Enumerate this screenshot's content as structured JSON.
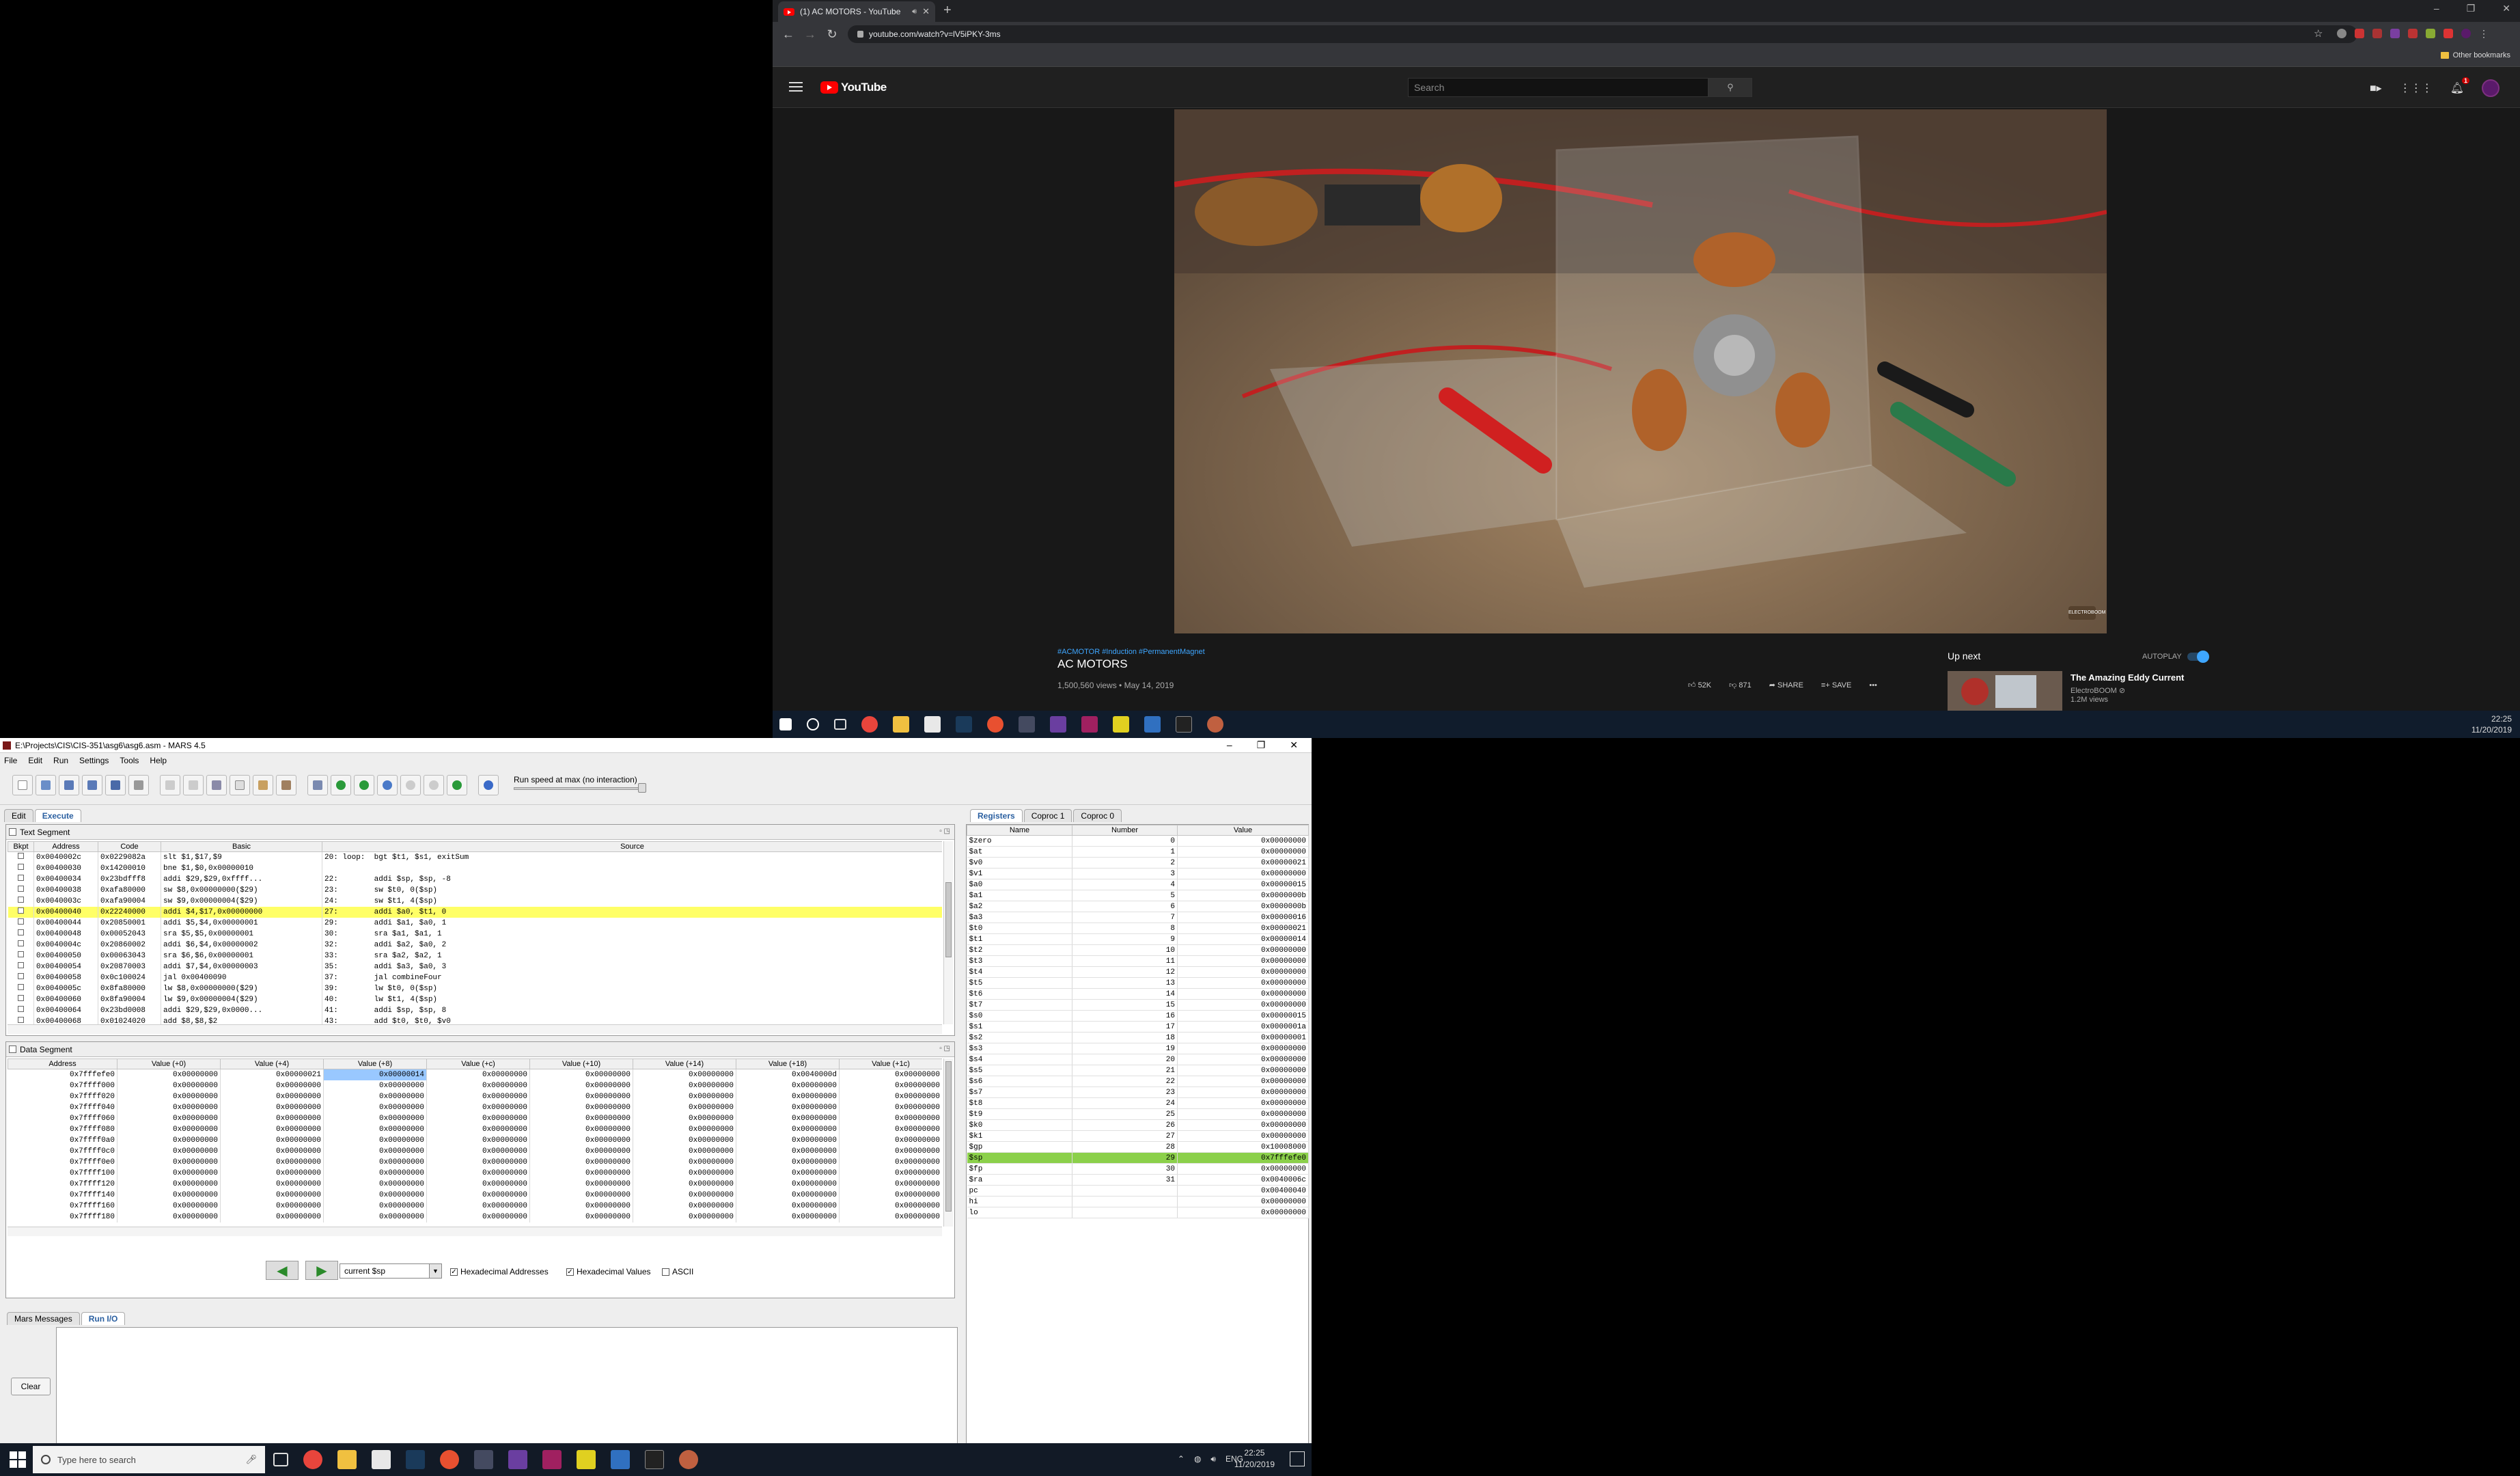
{
  "chrome": {
    "tab_title": "(1) AC MOTORS - YouTube",
    "new_tab": "+",
    "url": "youtube.com/watch?v=lV5iPKY-3ms",
    "other_bookmarks": "Other bookmarks",
    "window_controls": [
      "–",
      "❐",
      "✕"
    ]
  },
  "youtube": {
    "logo_text": "YouTube",
    "search_placeholder": "Search",
    "notification_count": "1",
    "hashtags": "#ACMOTOR #Induction #PermanentMagnet",
    "video_title": "AC MOTORS",
    "video_meta": "1,500,560 views • May 14, 2019",
    "likes": "52K",
    "dislikes": "871",
    "share": "SHARE",
    "save": "SAVE",
    "more": "•••",
    "up_next": "Up next",
    "autoplay": "AUTOPLAY",
    "related_title": "The Amazing Eddy Current",
    "related_channel": "ElectroBOOM ⊘",
    "related_views": "1.2M views",
    "watermark": "ELECTROBOOM"
  },
  "taskbar_top": {
    "time": "22:25",
    "date": "11/20/2019"
  },
  "mars": {
    "title": "E:\\Projects\\CIS\\CIS-351\\asg6\\asg6.asm - MARS 4.5",
    "menu": [
      "File",
      "Edit",
      "Run",
      "Settings",
      "Tools",
      "Help"
    ],
    "speed_label": "Run speed at max (no interaction)",
    "tabs": {
      "edit": "Edit",
      "execute": "Execute"
    },
    "text_segment": {
      "title": "Text Segment",
      "headers": [
        "Bkpt",
        "Address",
        "Code",
        "Basic",
        "Source"
      ],
      "rows": [
        [
          "0x0040002c",
          "0x0229082a",
          "slt $1,$17,$9",
          "20: loop:  bgt $t1, $s1, exitSum"
        ],
        [
          "0x00400030",
          "0x14200010",
          "bne $1,$0,0x00000010",
          ""
        ],
        [
          "0x00400034",
          "0x23bdfff8",
          "addi $29,$29,0xffff...",
          "22:        addi $sp, $sp, -8"
        ],
        [
          "0x00400038",
          "0xafa80000",
          "sw $8,0x00000000($29)",
          "23:        sw $t0, 0($sp)"
        ],
        [
          "0x0040003c",
          "0xafa90004",
          "sw $9,0x00000004($29)",
          "24:        sw $t1, 4($sp)"
        ],
        [
          "0x00400040",
          "0x22240000",
          "addi $4,$17,0x00000000",
          "27:        addi $a0, $t1, 0"
        ],
        [
          "0x00400044",
          "0x20850001",
          "addi $5,$4,0x00000001",
          "29:        addi $a1, $a0, 1"
        ],
        [
          "0x00400048",
          "0x00052043",
          "sra $5,$5,0x00000001",
          "30:        sra $a1, $a1, 1"
        ],
        [
          "0x0040004c",
          "0x20860002",
          "addi $6,$4,0x00000002",
          "32:        addi $a2, $a0, 2"
        ],
        [
          "0x00400050",
          "0x00063043",
          "sra $6,$6,0x00000001",
          "33:        sra $a2, $a2, 1"
        ],
        [
          "0x00400054",
          "0x20870003",
          "addi $7,$4,0x00000003",
          "35:        addi $a3, $a0, 3"
        ],
        [
          "0x00400058",
          "0x0c100024",
          "jal 0x00400090",
          "37:        jal combineFour"
        ],
        [
          "0x0040005c",
          "0x8fa80000",
          "lw $8,0x00000000($29)",
          "39:        lw $t0, 0($sp)"
        ],
        [
          "0x00400060",
          "0x8fa90004",
          "lw $9,0x00000004($29)",
          "40:        lw $t1, 4($sp)"
        ],
        [
          "0x00400064",
          "0x23bd0008",
          "addi $29,$29,0x0000...",
          "41:        addi $sp, $sp, 8"
        ],
        [
          "0x00400068",
          "0x01024020",
          "add $8,$8,$2",
          "43:        add $t0, $t0, $v0"
        ],
        [
          "0x0040006c",
          "0x21290001",
          "addi $9,$9,0x000...",
          "44:        addi $t1, $t1, 1"
        ]
      ]
    },
    "data_segment": {
      "title": "Data Segment",
      "headers": [
        "Address",
        "Value (+0)",
        "Value (+4)",
        "Value (+8)",
        "Value (+c)",
        "Value (+10)",
        "Value (+14)",
        "Value (+18)",
        "Value (+1c)"
      ],
      "rows": [
        [
          "0x7fffefe0",
          "0x00000000",
          "0x00000021",
          "0x00000014",
          "0x00000000",
          "0x00000000",
          "0x00000000",
          "0x0040000d",
          "0x00000000"
        ],
        [
          "0x7ffff000",
          "0x00000000",
          "0x00000000",
          "0x00000000",
          "0x00000000",
          "0x00000000",
          "0x00000000",
          "0x00000000",
          "0x00000000"
        ],
        [
          "0x7ffff020",
          "0x00000000",
          "0x00000000",
          "0x00000000",
          "0x00000000",
          "0x00000000",
          "0x00000000",
          "0x00000000",
          "0x00000000"
        ],
        [
          "0x7ffff040",
          "0x00000000",
          "0x00000000",
          "0x00000000",
          "0x00000000",
          "0x00000000",
          "0x00000000",
          "0x00000000",
          "0x00000000"
        ],
        [
          "0x7ffff060",
          "0x00000000",
          "0x00000000",
          "0x00000000",
          "0x00000000",
          "0x00000000",
          "0x00000000",
          "0x00000000",
          "0x00000000"
        ],
        [
          "0x7ffff080",
          "0x00000000",
          "0x00000000",
          "0x00000000",
          "0x00000000",
          "0x00000000",
          "0x00000000",
          "0x00000000",
          "0x00000000"
        ],
        [
          "0x7ffff0a0",
          "0x00000000",
          "0x00000000",
          "0x00000000",
          "0x00000000",
          "0x00000000",
          "0x00000000",
          "0x00000000",
          "0x00000000"
        ],
        [
          "0x7ffff0c0",
          "0x00000000",
          "0x00000000",
          "0x00000000",
          "0x00000000",
          "0x00000000",
          "0x00000000",
          "0x00000000",
          "0x00000000"
        ],
        [
          "0x7ffff0e0",
          "0x00000000",
          "0x00000000",
          "0x00000000",
          "0x00000000",
          "0x00000000",
          "0x00000000",
          "0x00000000",
          "0x00000000"
        ],
        [
          "0x7ffff100",
          "0x00000000",
          "0x00000000",
          "0x00000000",
          "0x00000000",
          "0x00000000",
          "0x00000000",
          "0x00000000",
          "0x00000000"
        ],
        [
          "0x7ffff120",
          "0x00000000",
          "0x00000000",
          "0x00000000",
          "0x00000000",
          "0x00000000",
          "0x00000000",
          "0x00000000",
          "0x00000000"
        ],
        [
          "0x7ffff140",
          "0x00000000",
          "0x00000000",
          "0x00000000",
          "0x00000000",
          "0x00000000",
          "0x00000000",
          "0x00000000",
          "0x00000000"
        ],
        [
          "0x7ffff160",
          "0x00000000",
          "0x00000000",
          "0x00000000",
          "0x00000000",
          "0x00000000",
          "0x00000000",
          "0x00000000",
          "0x00000000"
        ],
        [
          "0x7ffff180",
          "0x00000000",
          "0x00000000",
          "0x00000000",
          "0x00000000",
          "0x00000000",
          "0x00000000",
          "0x00000000",
          "0x00000000"
        ]
      ],
      "selector": "current $sp",
      "hex_addresses": "Hexadecimal Addresses",
      "hex_values": "Hexadecimal Values",
      "ascii": "ASCII"
    },
    "register_tabs": [
      "Registers",
      "Coproc 1",
      "Coproc 0"
    ],
    "registers": {
      "headers": [
        "Name",
        "Number",
        "Value"
      ],
      "rows": [
        [
          "$zero",
          "0",
          "0x00000000"
        ],
        [
          "$at",
          "1",
          "0x00000000"
        ],
        [
          "$v0",
          "2",
          "0x00000021"
        ],
        [
          "$v1",
          "3",
          "0x00000000"
        ],
        [
          "$a0",
          "4",
          "0x00000015"
        ],
        [
          "$a1",
          "5",
          "0x0000000b"
        ],
        [
          "$a2",
          "6",
          "0x0000000b"
        ],
        [
          "$a3",
          "7",
          "0x00000016"
        ],
        [
          "$t0",
          "8",
          "0x00000021"
        ],
        [
          "$t1",
          "9",
          "0x00000014"
        ],
        [
          "$t2",
          "10",
          "0x00000000"
        ],
        [
          "$t3",
          "11",
          "0x00000000"
        ],
        [
          "$t4",
          "12",
          "0x00000000"
        ],
        [
          "$t5",
          "13",
          "0x00000000"
        ],
        [
          "$t6",
          "14",
          "0x00000000"
        ],
        [
          "$t7",
          "15",
          "0x00000000"
        ],
        [
          "$s0",
          "16",
          "0x00000015"
        ],
        [
          "$s1",
          "17",
          "0x0000001a"
        ],
        [
          "$s2",
          "18",
          "0x00000001"
        ],
        [
          "$s3",
          "19",
          "0x00000000"
        ],
        [
          "$s4",
          "20",
          "0x00000000"
        ],
        [
          "$s5",
          "21",
          "0x00000000"
        ],
        [
          "$s6",
          "22",
          "0x00000000"
        ],
        [
          "$s7",
          "23",
          "0x00000000"
        ],
        [
          "$t8",
          "24",
          "0x00000000"
        ],
        [
          "$t9",
          "25",
          "0x00000000"
        ],
        [
          "$k0",
          "26",
          "0x00000000"
        ],
        [
          "$k1",
          "27",
          "0x00000000"
        ],
        [
          "$gp",
          "28",
          "0x10008000"
        ],
        [
          "$sp",
          "29",
          "0x7fffefe0"
        ],
        [
          "$fp",
          "30",
          "0x00000000"
        ],
        [
          "$ra",
          "31",
          "0x0040006c"
        ],
        [
          "pc",
          "",
          "0x00400040"
        ],
        [
          "hi",
          "",
          "0x00000000"
        ],
        [
          "lo",
          "",
          "0x00000000"
        ]
      ]
    },
    "message_tabs": [
      "Mars Messages",
      "Run I/O"
    ],
    "clear": "Clear"
  },
  "taskbar_bottom": {
    "search_placeholder": "Type here to search",
    "lang": "ENG",
    "time": "22:25",
    "date": "11/20/2019"
  }
}
